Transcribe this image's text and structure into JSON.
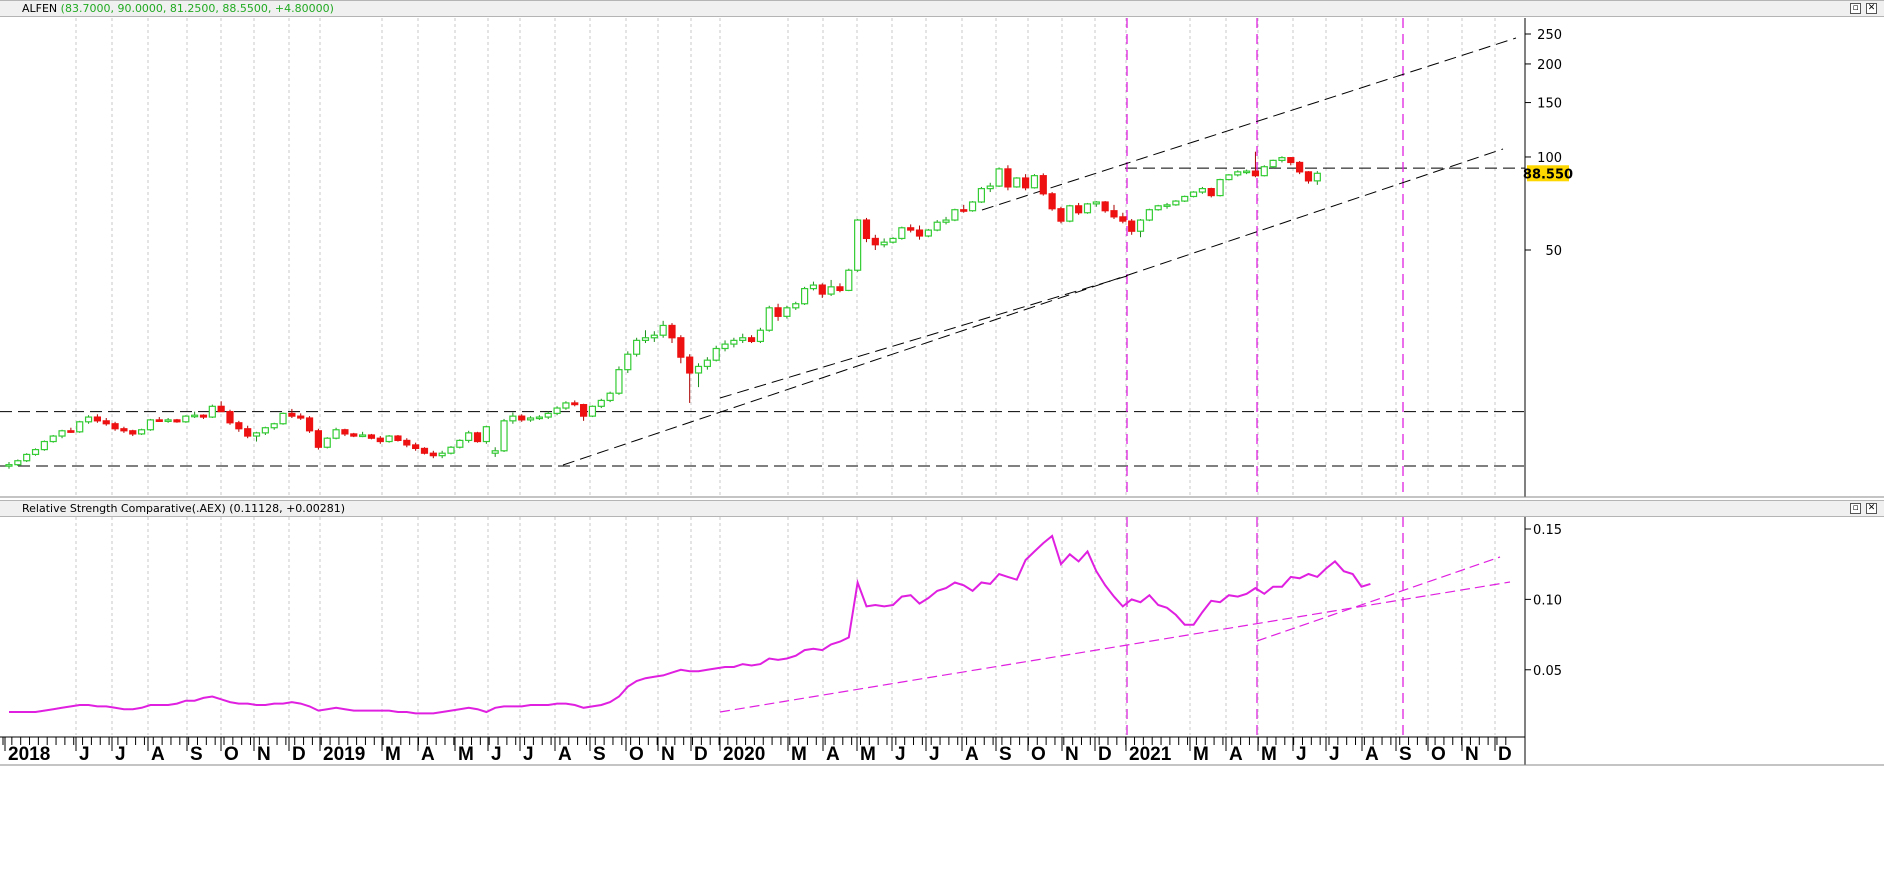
{
  "top_panel": {
    "symbol": "ALFEN",
    "ohlc_text": "(83.7000, 90.0000, 81.2500, 88.5500, +4.80000)",
    "last_price": "88.550",
    "last_price_color": "#ffd700",
    "up_color": "#33cc33",
    "down_color": "#ee1111"
  },
  "bottom_panel": {
    "indicator_name": "Relative Strength Comparative(.AEX)",
    "indicator_values": "(0.11128, +0.00281)",
    "line_color": "#e020e0"
  },
  "window_buttons": {
    "restore": "▫",
    "close": "✕"
  },
  "chart_data": [
    {
      "type": "candlestick",
      "title": "ALFEN",
      "y_scale": "log",
      "y_ticks": [
        50,
        100,
        150,
        200,
        250
      ],
      "weekly_ohlc": [
        [
          10.0,
          10.3,
          9.8,
          10.1
        ],
        [
          10.1,
          10.5,
          10.0,
          10.4
        ],
        [
          10.4,
          11.0,
          10.3,
          10.9
        ],
        [
          10.9,
          11.4,
          10.8,
          11.3
        ],
        [
          11.3,
          12.1,
          11.2,
          12.0
        ],
        [
          12.0,
          12.6,
          11.9,
          12.5
        ],
        [
          12.5,
          13.1,
          12.3,
          13.0
        ],
        [
          13.0,
          13.3,
          12.8,
          12.9
        ],
        [
          12.9,
          14.0,
          12.8,
          13.9
        ],
        [
          13.9,
          14.6,
          13.7,
          14.4
        ],
        [
          14.4,
          14.7,
          13.8,
          14.0
        ],
        [
          14.0,
          14.3,
          13.5,
          13.7
        ],
        [
          13.7,
          13.9,
          13.0,
          13.2
        ],
        [
          13.2,
          13.4,
          12.8,
          13.0
        ],
        [
          13.0,
          13.1,
          12.5,
          12.7
        ],
        [
          12.7,
          13.2,
          12.6,
          13.1
        ],
        [
          13.1,
          14.2,
          13.0,
          14.1
        ],
        [
          14.1,
          14.4,
          13.9,
          14.0
        ],
        [
          14.0,
          14.3,
          13.8,
          14.1
        ],
        [
          14.1,
          14.2,
          13.8,
          13.9
        ],
        [
          13.9,
          14.6,
          13.8,
          14.5
        ],
        [
          14.5,
          15.0,
          14.3,
          14.6
        ],
        [
          14.6,
          14.7,
          14.2,
          14.4
        ],
        [
          14.4,
          15.8,
          14.3,
          15.6
        ],
        [
          15.6,
          16.2,
          15.3,
          15.0
        ],
        [
          15.0,
          15.2,
          13.6,
          13.8
        ],
        [
          13.8,
          14.0,
          12.9,
          13.2
        ],
        [
          13.2,
          13.5,
          12.3,
          12.5
        ],
        [
          12.5,
          12.9,
          12.0,
          12.8
        ],
        [
          12.8,
          13.4,
          12.6,
          13.3
        ],
        [
          13.3,
          13.8,
          13.1,
          13.7
        ],
        [
          13.7,
          14.9,
          13.6,
          14.8
        ],
        [
          14.8,
          15.3,
          14.3,
          14.5
        ],
        [
          14.5,
          14.8,
          14.1,
          14.3
        ],
        [
          14.3,
          14.5,
          12.8,
          13.0
        ],
        [
          13.0,
          13.2,
          11.3,
          11.5
        ],
        [
          11.5,
          12.4,
          11.4,
          12.3
        ],
        [
          12.3,
          13.3,
          12.2,
          13.1
        ],
        [
          13.1,
          13.2,
          12.5,
          12.7
        ],
        [
          12.7,
          12.8,
          12.4,
          12.5
        ],
        [
          12.5,
          12.9,
          12.4,
          12.6
        ],
        [
          12.6,
          12.7,
          12.2,
          12.3
        ],
        [
          12.3,
          12.5,
          11.8,
          12.0
        ],
        [
          12.0,
          12.6,
          11.9,
          12.5
        ],
        [
          12.5,
          12.6,
          12.0,
          12.1
        ],
        [
          12.1,
          12.3,
          11.5,
          11.7
        ],
        [
          11.7,
          11.9,
          11.2,
          11.4
        ],
        [
          11.4,
          11.5,
          10.9,
          11.0
        ],
        [
          11.0,
          11.2,
          10.6,
          10.8
        ],
        [
          10.8,
          11.2,
          10.6,
          11.0
        ],
        [
          11.0,
          11.6,
          10.9,
          11.5
        ],
        [
          11.5,
          12.2,
          11.4,
          12.1
        ],
        [
          12.1,
          13.0,
          11.9,
          12.8
        ],
        [
          12.8,
          12.9,
          11.9,
          12.0
        ],
        [
          12.0,
          13.5,
          11.8,
          13.4
        ],
        [
          11.0,
          11.5,
          10.7,
          11.2
        ],
        [
          11.2,
          14.2,
          11.1,
          14.0
        ],
        [
          14.0,
          14.9,
          13.7,
          14.5
        ],
        [
          14.5,
          14.7,
          13.9,
          14.1
        ],
        [
          14.1,
          14.5,
          13.9,
          14.3
        ],
        [
          14.3,
          14.6,
          14.1,
          14.4
        ],
        [
          14.4,
          15.0,
          14.2,
          14.8
        ],
        [
          14.8,
          15.6,
          14.6,
          15.4
        ],
        [
          15.4,
          16.2,
          15.2,
          16.0
        ],
        [
          16.0,
          16.3,
          15.6,
          15.8
        ],
        [
          15.8,
          15.9,
          14.0,
          14.5
        ],
        [
          14.5,
          15.7,
          14.4,
          15.6
        ],
        [
          15.6,
          16.5,
          15.4,
          16.3
        ],
        [
          16.3,
          17.4,
          16.1,
          17.2
        ],
        [
          17.2,
          21.0,
          17.0,
          20.5
        ],
        [
          20.5,
          23.5,
          20.0,
          23.0
        ],
        [
          23.0,
          26.0,
          22.6,
          25.5
        ],
        [
          25.5,
          27.5,
          25.0,
          26.0
        ],
        [
          26.0,
          27.3,
          25.2,
          26.5
        ],
        [
          26.5,
          29.5,
          26.0,
          28.5
        ],
        [
          28.5,
          29.0,
          25.0,
          26.0
        ],
        [
          26.0,
          26.5,
          21.5,
          22.5
        ],
        [
          22.5,
          23.0,
          16.0,
          20.0
        ],
        [
          20.0,
          21.5,
          18.0,
          21.0
        ],
        [
          21.0,
          22.5,
          20.5,
          22.0
        ],
        [
          22.0,
          24.5,
          21.8,
          24.0
        ],
        [
          24.0,
          25.5,
          23.5,
          24.8
        ],
        [
          24.8,
          26.0,
          24.2,
          25.5
        ],
        [
          25.5,
          26.8,
          25.0,
          26.0
        ],
        [
          26.0,
          26.5,
          25.0,
          25.3
        ],
        [
          25.3,
          28.0,
          25.0,
          27.5
        ],
        [
          27.5,
          33.0,
          27.2,
          32.5
        ],
        [
          32.5,
          33.5,
          29.5,
          30.5
        ],
        [
          30.5,
          33.0,
          30.0,
          32.5
        ],
        [
          32.5,
          34.0,
          32.0,
          33.5
        ],
        [
          33.5,
          38.0,
          33.2,
          37.5
        ],
        [
          37.5,
          39.5,
          37.0,
          38.5
        ],
        [
          38.5,
          39.0,
          35.0,
          36.0
        ],
        [
          36.0,
          40.0,
          35.5,
          38.0
        ],
        [
          38.0,
          39.0,
          36.5,
          37.0
        ],
        [
          37.0,
          43.5,
          36.8,
          43.0
        ],
        [
          43.0,
          63.0,
          42.5,
          62.5
        ],
        [
          62.5,
          63.5,
          53.0,
          54.5
        ],
        [
          54.5,
          56.0,
          50.0,
          52.0
        ],
        [
          52.0,
          54.5,
          51.0,
          53.0
        ],
        [
          53.0,
          55.0,
          52.5,
          54.5
        ],
        [
          54.5,
          59.5,
          54.0,
          59.0
        ],
        [
          59.0,
          60.5,
          57.0,
          58.0
        ],
        [
          58.0,
          60.0,
          54.0,
          55.5
        ],
        [
          55.5,
          58.5,
          55.0,
          58.0
        ],
        [
          58.0,
          62.5,
          57.5,
          61.5
        ],
        [
          61.5,
          64.0,
          60.5,
          62.5
        ],
        [
          62.5,
          68.0,
          62.0,
          67.5
        ],
        [
          67.5,
          70.0,
          66.0,
          67.0
        ],
        [
          67.0,
          72.0,
          66.5,
          71.5
        ],
        [
          71.5,
          80.0,
          71.0,
          79.0
        ],
        [
          79.0,
          82.5,
          77.0,
          80.5
        ],
        [
          80.5,
          92.5,
          80.0,
          91.5
        ],
        [
          91.5,
          94.0,
          78.0,
          80.0
        ],
        [
          80.0,
          86.0,
          79.5,
          85.5
        ],
        [
          85.5,
          88.0,
          78.0,
          79.5
        ],
        [
          79.5,
          88.0,
          79.0,
          87.0
        ],
        [
          87.0,
          88.5,
          75.0,
          76.0
        ],
        [
          76.0,
          77.0,
          67.0,
          68.0
        ],
        [
          68.0,
          69.0,
          61.0,
          62.0
        ],
        [
          62.0,
          70.0,
          61.5,
          69.5
        ],
        [
          69.5,
          71.0,
          65.0,
          66.0
        ],
        [
          66.0,
          71.0,
          65.5,
          70.5
        ],
        [
          70.5,
          72.0,
          69.0,
          71.5
        ],
        [
          71.5,
          72.0,
          66.0,
          67.0
        ],
        [
          67.0,
          70.0,
          63.0,
          64.0
        ],
        [
          64.0,
          66.0,
          61.0,
          62.0
        ],
        [
          62.0,
          63.0,
          56.0,
          57.5
        ],
        [
          57.5,
          63.0,
          55.0,
          62.5
        ],
        [
          62.5,
          68.0,
          62.0,
          67.5
        ],
        [
          67.5,
          70.0,
          67.0,
          69.5
        ],
        [
          69.5,
          71.0,
          68.0,
          70.0
        ],
        [
          70.0,
          72.5,
          69.5,
          72.0
        ],
        [
          72.0,
          75.0,
          71.5,
          74.5
        ],
        [
          74.5,
          77.5,
          74.0,
          77.0
        ],
        [
          77.0,
          80.0,
          76.0,
          79.0
        ],
        [
          79.0,
          79.5,
          74.0,
          75.0
        ],
        [
          75.0,
          85.0,
          74.5,
          84.5
        ],
        [
          84.5,
          88.0,
          84.0,
          87.5
        ],
        [
          87.5,
          90.5,
          86.5,
          89.5
        ],
        [
          89.5,
          91.0,
          88.0,
          90.0
        ],
        [
          90.0,
          104.0,
          86.0,
          87.0
        ],
        [
          87.0,
          94.0,
          86.5,
          93.0
        ],
        [
          93.0,
          98.0,
          92.0,
          97.5
        ],
        [
          97.5,
          100.5,
          96.0,
          99.5
        ],
        [
          99.5,
          100.0,
          94.0,
          96.0
        ],
        [
          96.0,
          97.0,
          88.0,
          89.5
        ],
        [
          89.5,
          90.0,
          82.0,
          83.7
        ],
        [
          83.7,
          90.0,
          81.25,
          88.55
        ]
      ],
      "reference_lines": {
        "horizontal": [
          15.0,
          10.0,
          92.0
        ]
      },
      "series": [
        {
          "name": "ALFEN"
        }
      ]
    },
    {
      "type": "line",
      "title": "Relative Strength Comparative(.AEX)",
      "y_ticks": [
        0.05,
        0.1,
        0.15
      ],
      "ylim": [
        0,
        0.155
      ],
      "series": [
        {
          "name": "Relative Strength Comparative(.AEX)",
          "values": [
            0.02,
            0.02,
            0.02,
            0.02,
            0.021,
            0.022,
            0.023,
            0.024,
            0.025,
            0.025,
            0.024,
            0.024,
            0.023,
            0.022,
            0.022,
            0.023,
            0.025,
            0.025,
            0.025,
            0.026,
            0.028,
            0.028,
            0.03,
            0.031,
            0.029,
            0.027,
            0.026,
            0.026,
            0.025,
            0.025,
            0.026,
            0.026,
            0.027,
            0.026,
            0.024,
            0.021,
            0.022,
            0.023,
            0.022,
            0.021,
            0.021,
            0.021,
            0.021,
            0.021,
            0.02,
            0.02,
            0.019,
            0.019,
            0.019,
            0.02,
            0.021,
            0.022,
            0.023,
            0.022,
            0.02,
            0.023,
            0.024,
            0.024,
            0.024,
            0.025,
            0.025,
            0.025,
            0.026,
            0.026,
            0.025,
            0.023,
            0.024,
            0.025,
            0.027,
            0.031,
            0.038,
            0.042,
            0.044,
            0.045,
            0.046,
            0.048,
            0.05,
            0.049,
            0.049,
            0.05,
            0.051,
            0.052,
            0.052,
            0.054,
            0.053,
            0.054,
            0.058,
            0.057,
            0.058,
            0.06,
            0.064,
            0.065,
            0.064,
            0.068,
            0.07,
            0.073,
            0.112,
            0.095,
            0.096,
            0.095,
            0.096,
            0.102,
            0.103,
            0.097,
            0.101,
            0.106,
            0.108,
            0.112,
            0.11,
            0.106,
            0.112,
            0.111,
            0.118,
            0.116,
            0.114,
            0.128,
            0.134,
            0.14,
            0.145,
            0.125,
            0.132,
            0.127,
            0.134,
            0.12,
            0.11,
            0.102,
            0.095,
            0.1,
            0.098,
            0.103,
            0.096,
            0.094,
            0.089,
            0.082,
            0.082,
            0.091,
            0.099,
            0.098,
            0.103,
            0.102,
            0.104,
            0.108,
            0.104,
            0.109,
            0.109,
            0.116,
            0.115,
            0.118,
            0.116,
            0.122,
            0.127,
            0.12,
            0.118,
            0.109,
            0.111
          ]
        }
      ]
    }
  ],
  "x_axis": {
    "labels": [
      "2018",
      "J",
      "J",
      "A",
      "S",
      "O",
      "N",
      "D",
      "2019",
      "M",
      "A",
      "M",
      "J",
      "J",
      "A",
      "S",
      "O",
      "N",
      "D",
      "2020",
      "M",
      "A",
      "M",
      "J",
      "J",
      "A",
      "S",
      "O",
      "N",
      "D",
      "2021",
      "M",
      "A",
      "M",
      "J",
      "J",
      "A",
      "S",
      "O",
      "N",
      "D"
    ]
  }
}
